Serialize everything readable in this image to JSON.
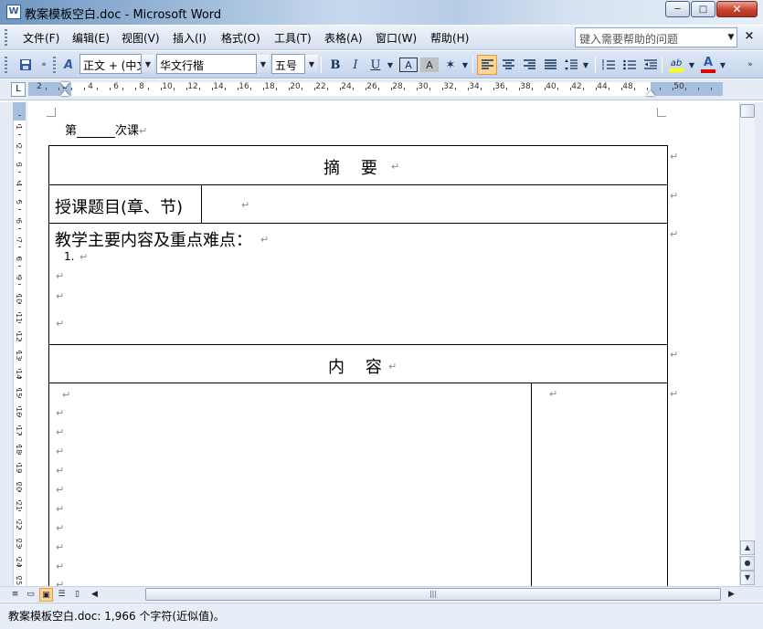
{
  "window": {
    "title": "教案模板空白.doc - Microsoft Word",
    "app_icon": "word-doc-icon",
    "minimize": "─",
    "maximize": "□",
    "close": "✕"
  },
  "menu": {
    "items": [
      "文件(F)",
      "编辑(E)",
      "视图(V)",
      "插入(I)",
      "格式(O)",
      "工具(T)",
      "表格(A)",
      "窗口(W)",
      "帮助(H)"
    ],
    "help_placeholder": "键入需要帮助的问题",
    "close_glyph": "×"
  },
  "toolbar": {
    "style_value": "正文 + (中文",
    "font_value": "华文行楷",
    "size_value": "五号",
    "bold": "B",
    "italic": "I",
    "underline": "U",
    "border_char": "A",
    "shade_char": "A",
    "font_color": "A",
    "highlight": "ab",
    "active_alignment": "left"
  },
  "ruler": {
    "horizontal_labels": [
      "2",
      "2",
      "4",
      "6",
      "8",
      "10",
      "12",
      "14",
      "16",
      "18",
      "20",
      "22",
      "24",
      "26",
      "28",
      "30",
      "32",
      "34",
      "36",
      "38",
      "40",
      "42",
      "44",
      "48",
      "50"
    ],
    "vertical_labels": [
      "1",
      "2",
      "3",
      "4",
      "5",
      "6",
      "7",
      "8",
      "9",
      "10",
      "11",
      "12",
      "13",
      "14",
      "15",
      "16",
      "17",
      "18",
      "19",
      "20",
      "21",
      "22",
      "23",
      "24",
      "25"
    ],
    "tab_selector": "L"
  },
  "document": {
    "lesson_prefix": "第",
    "lesson_suffix": "次课",
    "summary_header": "摘    要",
    "topic_label": "授课题目(章、节)",
    "main_content_label": "教学主要内容及重点难点：",
    "list_marker": "1.",
    "content_header": "内    容",
    "paragraph_mark": "↵"
  },
  "statusbar": {
    "text": "教案模板空白.doc: 1,966 个字符(近似值)。"
  },
  "colors": {
    "highlight_yellow": "#ffff00",
    "font_color_red": "#e00000",
    "active_button": "#fcd494"
  }
}
